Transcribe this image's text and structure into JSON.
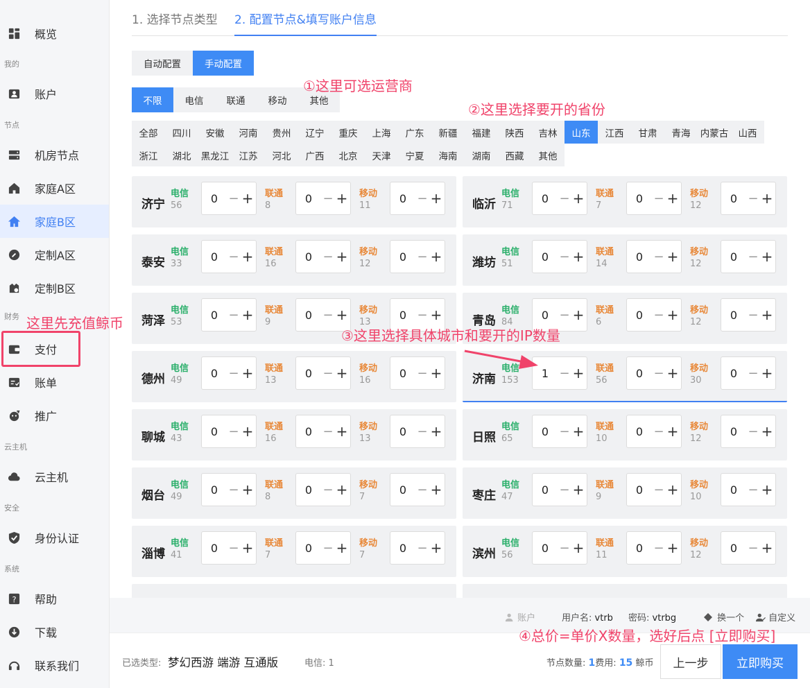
{
  "sidebar": {
    "items": [
      {
        "label": "概览",
        "icon": "dashboard-icon"
      },
      {
        "label": "账户",
        "icon": "account-icon"
      },
      {
        "label": "机房节点",
        "icon": "server-icon"
      },
      {
        "label": "家庭A区",
        "icon": "home-a-icon"
      },
      {
        "label": "家庭B区",
        "icon": "home-icon"
      },
      {
        "label": "定制A区",
        "icon": "wrench-icon"
      },
      {
        "label": "定制B区",
        "icon": "custom-b-icon"
      },
      {
        "label": "支付",
        "icon": "wallet-icon"
      },
      {
        "label": "账单",
        "icon": "bill-icon"
      },
      {
        "label": "推广",
        "icon": "promote-icon"
      },
      {
        "label": "云主机",
        "icon": "cloud-icon"
      },
      {
        "label": "身份认证",
        "icon": "shield-icon"
      },
      {
        "label": "帮助",
        "icon": "help-icon"
      },
      {
        "label": "下载",
        "icon": "download-icon"
      },
      {
        "label": "联系我们",
        "icon": "headset-icon"
      }
    ],
    "headers": [
      "我的",
      "节点",
      "财务",
      "云主机",
      "安全",
      "系统"
    ],
    "active": "家庭B区"
  },
  "steps": [
    "1. 选择节点类型",
    "2. 配置节点&填写账户信息"
  ],
  "config_mode": {
    "options": [
      "自动配置",
      "手动配置"
    ],
    "selected": "手动配置"
  },
  "carrier_filter": {
    "options": [
      "不限",
      "电信",
      "联通",
      "移动",
      "其他"
    ],
    "selected": "不限"
  },
  "provinces": {
    "row1": [
      "全部",
      "四川",
      "安徽",
      "河南",
      "贵州",
      "辽宁",
      "重庆",
      "上海",
      "广东",
      "新疆",
      "福建",
      "陕西",
      "吉林",
      "山东",
      "江西",
      "甘肃",
      "青海",
      "内蒙古",
      "山西"
    ],
    "row2": [
      "浙江",
      "湖北",
      "黑龙江",
      "江苏",
      "河北",
      "广西",
      "北京",
      "天津",
      "宁夏",
      "海南",
      "湖南",
      "西藏",
      "其他"
    ],
    "selected": "山东"
  },
  "carrier_names": {
    "tel": "电信",
    "uni": "联通",
    "mob": "移动"
  },
  "cities": [
    {
      "name": "济宁",
      "tel": 56,
      "uni": 8,
      "mob": 11,
      "qtel": 0,
      "quni": 0,
      "qmob": 0
    },
    {
      "name": "临沂",
      "tel": 71,
      "uni": 7,
      "mob": 12,
      "qtel": 0,
      "quni": 0,
      "qmob": 0
    },
    {
      "name": "泰安",
      "tel": 33,
      "uni": 16,
      "mob": 12,
      "qtel": 0,
      "quni": 0,
      "qmob": 0
    },
    {
      "name": "潍坊",
      "tel": 51,
      "uni": 14,
      "mob": 12,
      "qtel": 0,
      "quni": 0,
      "qmob": 0
    },
    {
      "name": "菏泽",
      "tel": 53,
      "uni": 9,
      "mob": 13,
      "qtel": 0,
      "quni": 0,
      "qmob": 0
    },
    {
      "name": "青岛",
      "tel": 84,
      "uni": 6,
      "mob": 12,
      "qtel": 0,
      "quni": 0,
      "qmob": 0
    },
    {
      "name": "德州",
      "tel": 49,
      "uni": 13,
      "mob": 16,
      "qtel": 0,
      "quni": 0,
      "qmob": 0
    },
    {
      "name": "济南",
      "tel": 153,
      "uni": 56,
      "mob": 30,
      "qtel": 1,
      "quni": 0,
      "qmob": 0
    },
    {
      "name": "聊城",
      "tel": 43,
      "uni": 16,
      "mob": 13,
      "qtel": 0,
      "quni": 0,
      "qmob": 0
    },
    {
      "name": "日照",
      "tel": 65,
      "uni": 10,
      "mob": 12,
      "qtel": 0,
      "quni": 0,
      "qmob": 0
    },
    {
      "name": "烟台",
      "tel": 49,
      "uni": 8,
      "mob": 7,
      "qtel": 0,
      "quni": 0,
      "qmob": 0
    },
    {
      "name": "枣庄",
      "tel": 47,
      "uni": 9,
      "mob": 10,
      "qtel": 0,
      "quni": 0,
      "qmob": 0
    },
    {
      "name": "淄博",
      "tel": 41,
      "uni": 7,
      "mob": 7,
      "qtel": 0,
      "quni": 0,
      "qmob": 0
    },
    {
      "name": "滨州",
      "tel": 56,
      "uni": 11,
      "mob": 12,
      "qtel": 0,
      "quni": 0,
      "qmob": 0
    }
  ],
  "account": {
    "label": "账户",
    "username_label": "用户名:",
    "username": "vtrb",
    "password_label": "密码:",
    "password": "vtrbg",
    "change_label": "换一个",
    "custom_label": "自定义"
  },
  "footer": {
    "selected_type_label": "已选类型:",
    "selected_type": "梦幻西游 端游 互通版",
    "tel_label": "电信:",
    "tel_count": "1",
    "node_count_label": "节点数量:",
    "node_count": "1",
    "fee_label": "费用:",
    "fee": "15",
    "currency": "鲸币",
    "prev_button": "上一步",
    "buy_button": "立即购买"
  },
  "annotations": {
    "carrier": "①这里可选运营商",
    "province": "②这里选择要开的省份",
    "city": "③这里选择具体城市和要开的IP数量",
    "total": "④总价=单价X数量，选好后点 [立即购买]",
    "recharge": "这里先充值鲸币"
  },
  "colors": {
    "accent": "#3e8bf5",
    "annotation": "#f0436a",
    "telecom": "#2aaf6a",
    "unicom_mobile": "#e8893a"
  }
}
